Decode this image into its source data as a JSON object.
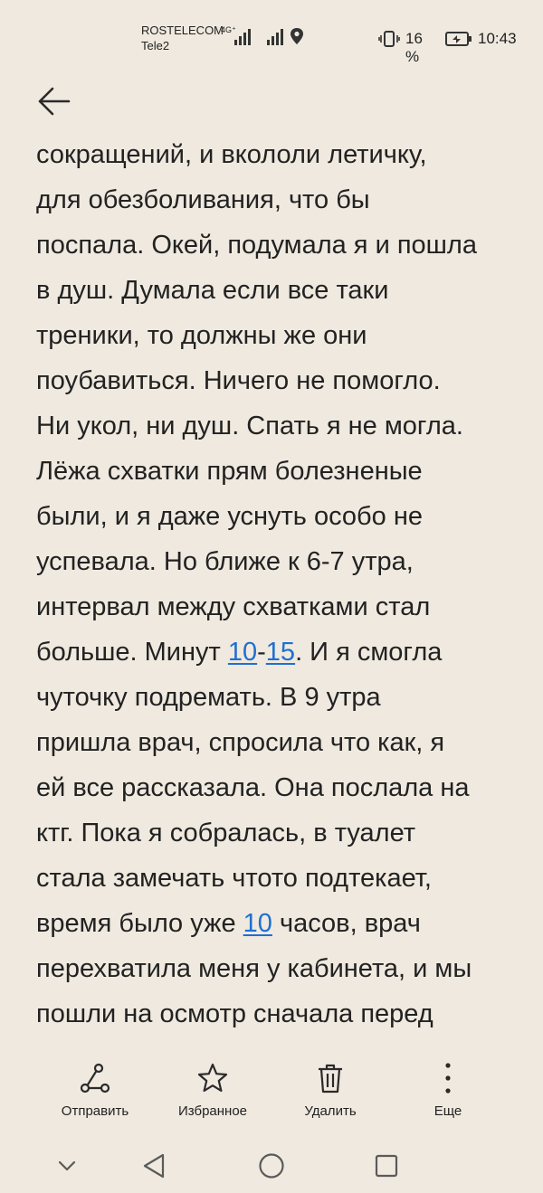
{
  "status_bar": {
    "carrier_1": "ROSTELECOM",
    "carrier_2": "Tele2",
    "network": "4G⁺",
    "battery": "16 %",
    "time": "10:43"
  },
  "note": {
    "segments": [
      {
        "text": "сокращений, и вкололи летичку,\nдля обезболивания, что бы\nпоспала. Окей, подумала я и пошла\nв душ. Думала если все таки\nтреники, то должны же они\nпоубавиться. Ничего не помогло.\nНи укол, ни душ. Спать я не могла.\nЛёжа схватки прям болезненые\nбыли, и я даже уснуть особо не\nуспевала. Но ближе к 6-7 утра,\nинтервал между схватками стал\nбольше. Минут ",
        "link": false
      },
      {
        "text": "10",
        "link": true
      },
      {
        "text": "-",
        "link": false
      },
      {
        "text": "15",
        "link": true
      },
      {
        "text": ". И я смогла\nчуточку подремать. В 9 утра\nпришла врач, спросила что как, я\nей все рассказала. Она послала на\nктг. Пока я собралась, в туалет\nстала замечать чтото подтекает,\nвремя было уже ",
        "link": false
      },
      {
        "text": "10",
        "link": true
      },
      {
        "text": " часов, врач\nперехватила меня у кабинета, и мы\nпошли на осмотр сначала перед\n—",
        "link": false
      }
    ],
    "link_color": "#1f6fd1"
  },
  "toolbar": {
    "send_label": "Отправить",
    "favorite_label": "Избранное",
    "delete_label": "Удалить",
    "more_label": "Еще"
  },
  "icons": {
    "back": "arrow-left-icon",
    "send": "share-icon",
    "favorite": "star-icon",
    "delete": "trash-icon",
    "more": "more-vertical-icon"
  }
}
